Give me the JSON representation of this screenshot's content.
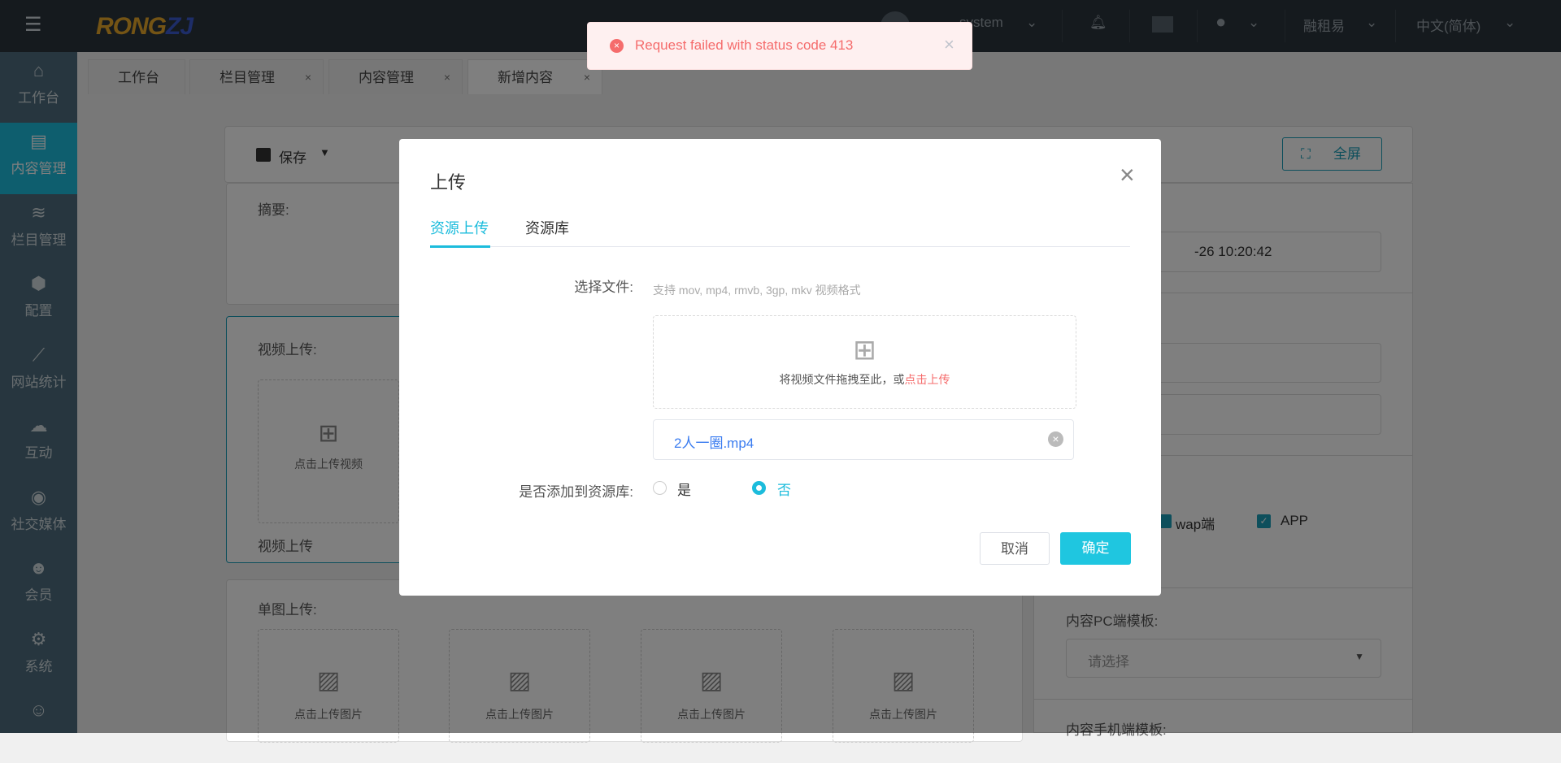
{
  "header": {
    "logo": "RONGZJ",
    "user": "system",
    "tenant": "融租易",
    "language": "中文(简体)"
  },
  "sidebar": {
    "items": [
      {
        "label": "工作台",
        "icon": "⌂"
      },
      {
        "label": "内容管理",
        "icon": "▤",
        "active": true
      },
      {
        "label": "栏目管理",
        "icon": "≋"
      },
      {
        "label": "配置",
        "icon": "⬢"
      },
      {
        "label": "网站统计",
        "icon": "⟋"
      },
      {
        "label": "互动",
        "icon": "☁"
      },
      {
        "label": "社交媒体",
        "icon": "◉"
      },
      {
        "label": "会员",
        "icon": "☻"
      },
      {
        "label": "系统",
        "icon": "⚙"
      },
      {
        "label": "",
        "icon": "☺"
      }
    ]
  },
  "tabs": [
    {
      "label": "工作台"
    },
    {
      "label": "栏目管理",
      "close": "×"
    },
    {
      "label": "内容管理",
      "close": "×"
    },
    {
      "label": "新增内容",
      "close": "×"
    }
  ],
  "toolbar": {
    "save": "保存",
    "fullscreen": "全屏"
  },
  "form": {
    "summary_label": "摘要:",
    "video_label": "视频上传:",
    "video_box": "点击上传视频",
    "video_caption": "视频上传",
    "image_label": "单图上传:",
    "image_box": "点击上传图片"
  },
  "right": {
    "publish_time": "-26 10:20:42",
    "wap": "wap端",
    "app": "APP",
    "pc_template_label": "内容PC端模板:",
    "pc_template_placeholder": "请选择",
    "mobile_template_label": "内容手机端模板:"
  },
  "toast": {
    "message": "Request failed with status code 413",
    "close": "×"
  },
  "dialog": {
    "title": "上传",
    "close": "×",
    "tabs": [
      "资源上传",
      "资源库"
    ],
    "file_label": "选择文件:",
    "file_hint": "支持 mov, mp4, rmvb, 3gp, mkv 视频格式",
    "drop_text": "将视频文件拖拽至此，或",
    "drop_link": "点击上传",
    "file_name": "2人一圈.mp4",
    "library_label": "是否添加到资源库:",
    "yes": "是",
    "no": "否",
    "cancel": "取消",
    "confirm": "确定"
  },
  "colors": {
    "accent": "#1cbcdc",
    "error": "#f56c6c",
    "link": "#3a7cf0"
  }
}
